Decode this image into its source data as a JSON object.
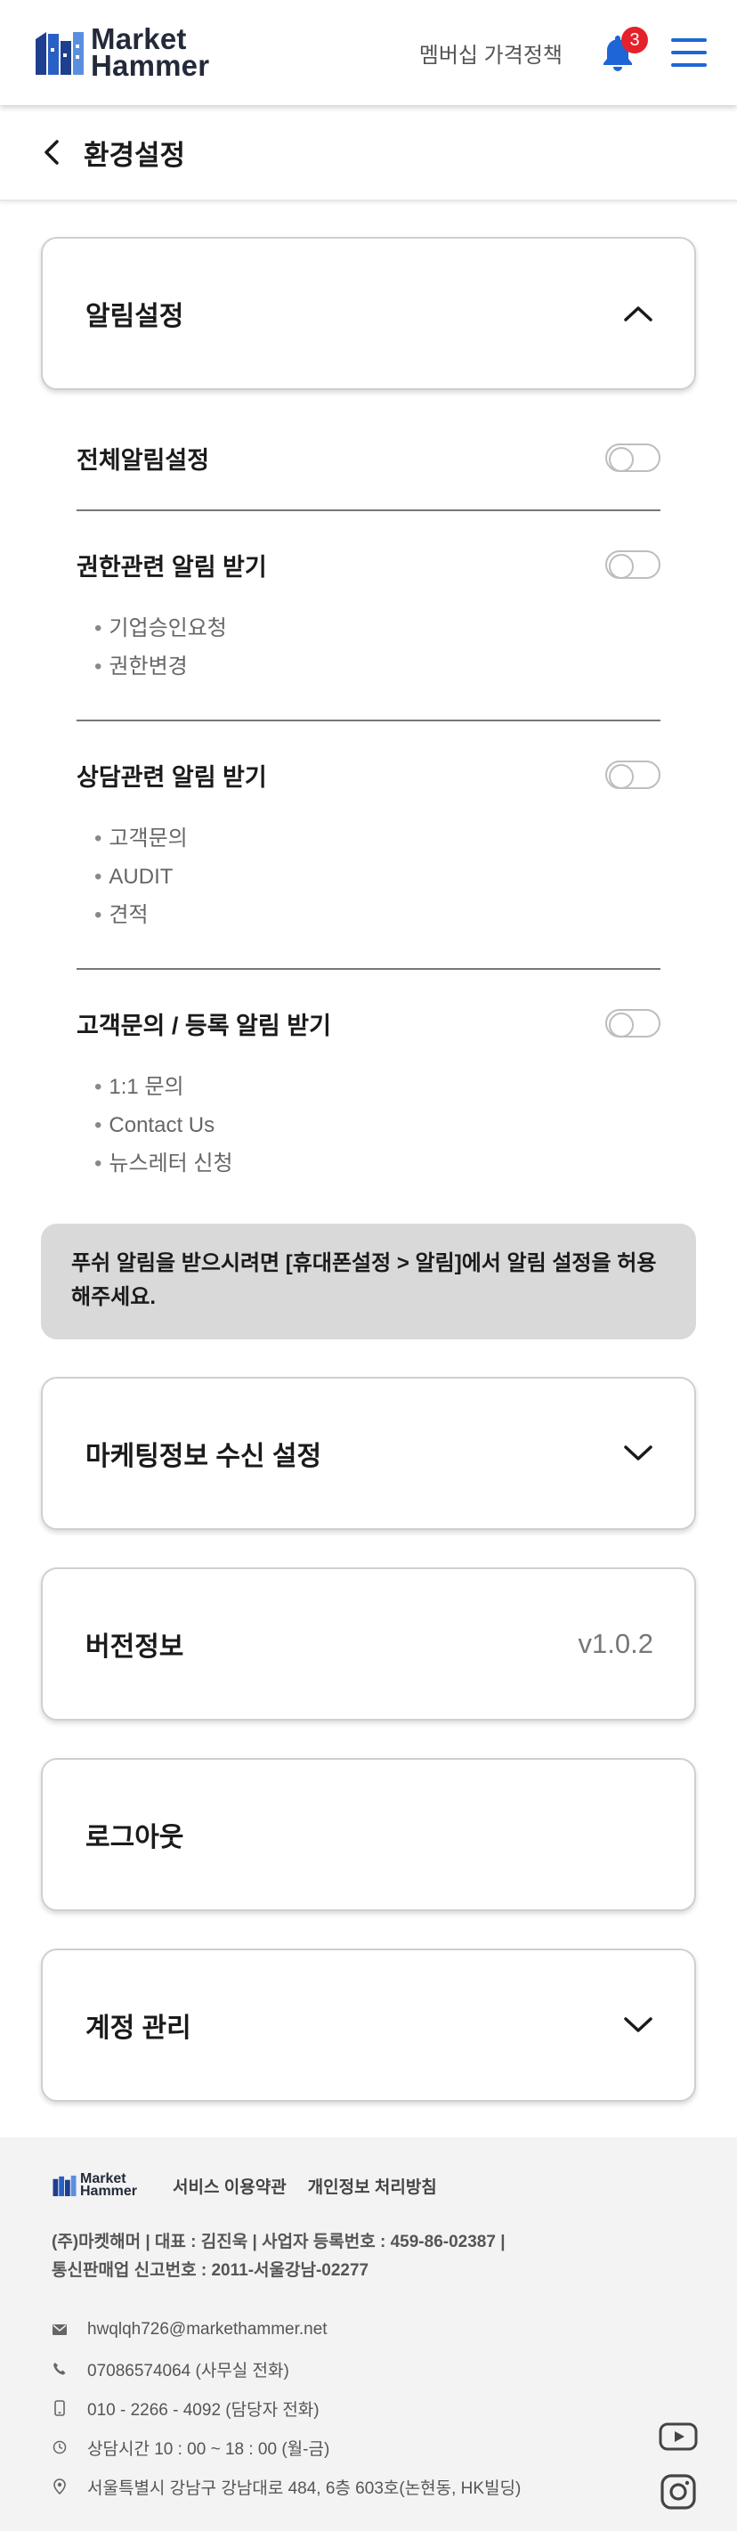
{
  "header": {
    "logo_line1": "Market",
    "logo_line2": "Hammer",
    "membership_link": "멤버십 가격정책",
    "notification_count": "3",
    "accent_color": "#1e66d6",
    "badge_color": "#e5212b"
  },
  "titlebar": {
    "title": "환경설정"
  },
  "notification_card": {
    "title": "알림설정",
    "expanded": true
  },
  "settings": [
    {
      "label": "전체알림설정",
      "enabled": false,
      "items": []
    },
    {
      "label": "권한관련 알림 받기",
      "enabled": false,
      "items": [
        "기업승인요청",
        "권한변경"
      ]
    },
    {
      "label": "상담관련 알림 받기",
      "enabled": false,
      "items": [
        "고객문의",
        "AUDIT",
        "견적"
      ]
    },
    {
      "label": "고객문의 / 등록 알림 받기",
      "enabled": false,
      "items": [
        "1:1 문의",
        "Contact Us",
        "뉴스레터 신청"
      ]
    }
  ],
  "notice": {
    "text": "푸쉬 알림을 받으시려면 [휴대폰설정 > 알림]에서 알림 설정을 허용해주세요."
  },
  "marketing_card": {
    "title": "마케팅정보 수신 설정"
  },
  "version_card": {
    "title": "버전정보",
    "value": "v1.0.2"
  },
  "logout_card": {
    "title": "로그아웃"
  },
  "account_card": {
    "title": "계정 관리"
  },
  "footer": {
    "logo_line1": "Market",
    "logo_line2": "Hammer",
    "terms_link": "서비스 이용약관",
    "privacy_link": "개인정보 처리방침",
    "company_line1": "(주)마켓해머 | 대표 : 김진욱 | 사업자 등록번호 : 459-86-02387 |",
    "company_line2": "통신판매업 신고번호 : 2011-서울강남-02277",
    "email": "hwqlqh726@markethammer.net",
    "office_phone": "07086574064 (사무실 전화)",
    "mobile_phone": "010 - 2266 - 4092 (담당자 전화)",
    "hours": "상담시간 10 : 00 ~ 18 : 00 (월-금)",
    "address": "서울특별시 강남구 강남대로 484, 6층 603호(논현동, HK빌딩)"
  }
}
